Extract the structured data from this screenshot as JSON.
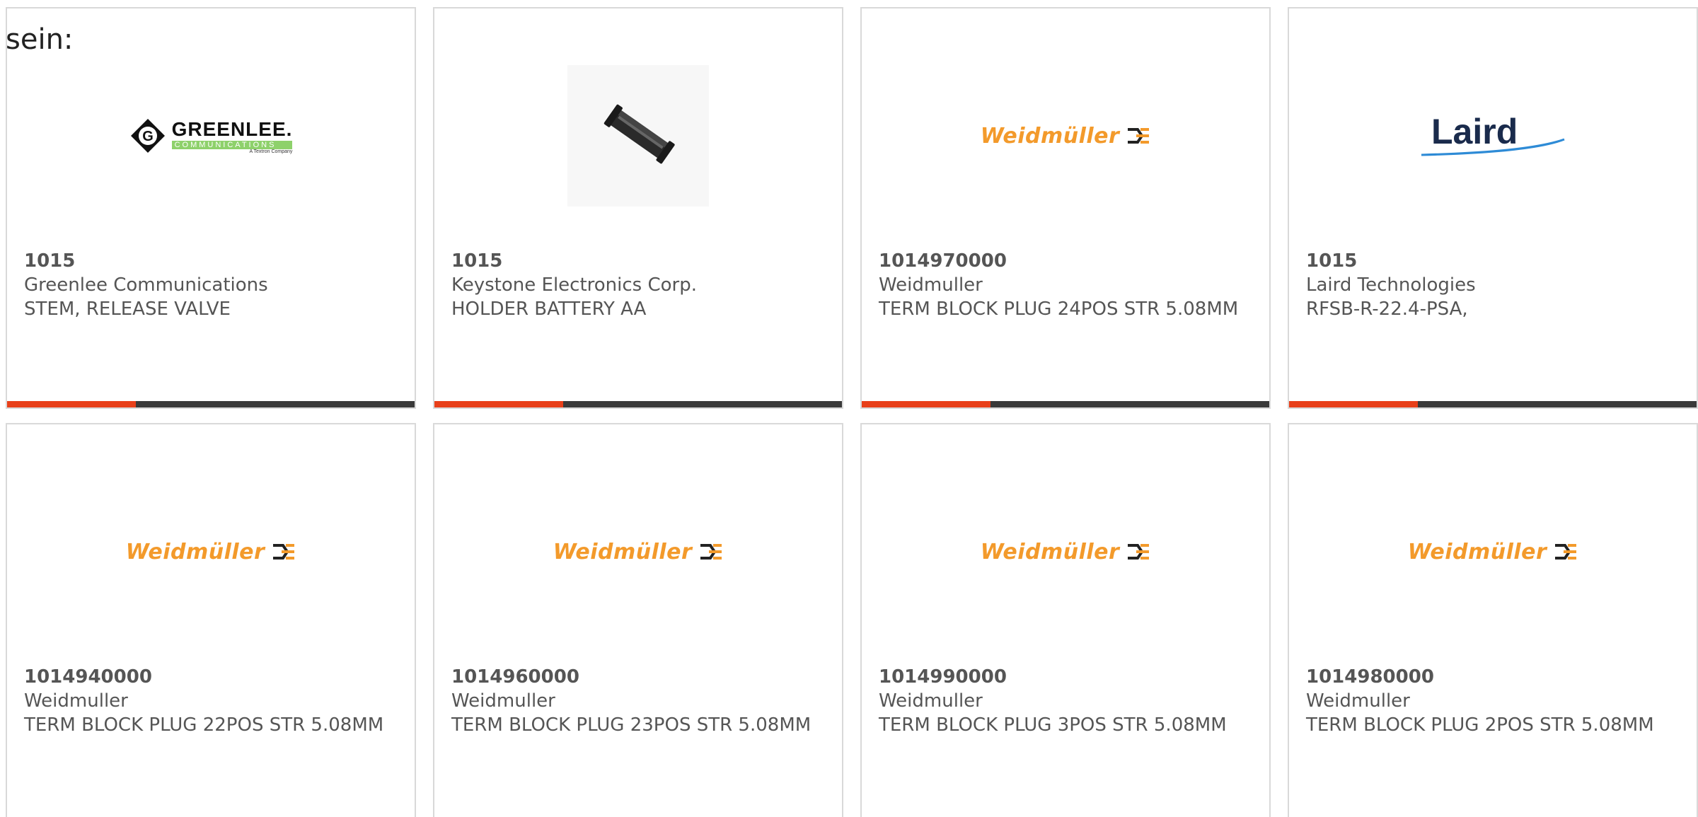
{
  "intro_text": "sein:",
  "products": [
    {
      "part_number": "1015",
      "manufacturer": "Greenlee Communications",
      "description": "STEM, RELEASE VALVE",
      "logo": "greenlee-logo",
      "logo_text": "GREENLEE.",
      "logo_subtext": "COMMUNICATIONS",
      "logo_tagline": "A Textron Company"
    },
    {
      "part_number": "1015",
      "manufacturer": "Keystone Electronics Corp.",
      "description": "HOLDER BATTERY AA",
      "logo": "battery-holder-photo"
    },
    {
      "part_number": "1014970000",
      "manufacturer": "Weidmuller",
      "description": "TERM BLOCK PLUG 24POS STR 5.08MM",
      "logo": "weidmuller-logo",
      "logo_text": "Weidmüller"
    },
    {
      "part_number": "1015",
      "manufacturer": "Laird Technologies",
      "description": "RFSB-R-22.4-PSA,",
      "logo": "laird-logo",
      "logo_text": "Laird"
    },
    {
      "part_number": "1014940000",
      "manufacturer": "Weidmuller",
      "description": "TERM BLOCK PLUG 22POS STR 5.08MM",
      "logo": "weidmuller-logo",
      "logo_text": "Weidmüller"
    },
    {
      "part_number": "1014960000",
      "manufacturer": "Weidmuller",
      "description": "TERM BLOCK PLUG 23POS STR 5.08MM",
      "logo": "weidmuller-logo",
      "logo_text": "Weidmüller"
    },
    {
      "part_number": "1014990000",
      "manufacturer": "Weidmuller",
      "description": "TERM BLOCK PLUG 3POS STR 5.08MM",
      "logo": "weidmuller-logo",
      "logo_text": "Weidmüller"
    },
    {
      "part_number": "1014980000",
      "manufacturer": "Weidmuller",
      "description": "TERM BLOCK PLUG 2POS STR 5.08MM",
      "logo": "weidmuller-logo",
      "logo_text": "Weidmüller"
    }
  ],
  "colors": {
    "accent": "#e8401a",
    "bar": "#3a3a3a",
    "border": "#d9d9d9",
    "text": "#555555",
    "weidmuller_orange": "#f39a2b",
    "laird_navy": "#1a2b4c",
    "laird_swoosh": "#2e8bd6",
    "greenlee_green": "#8ed16b"
  }
}
